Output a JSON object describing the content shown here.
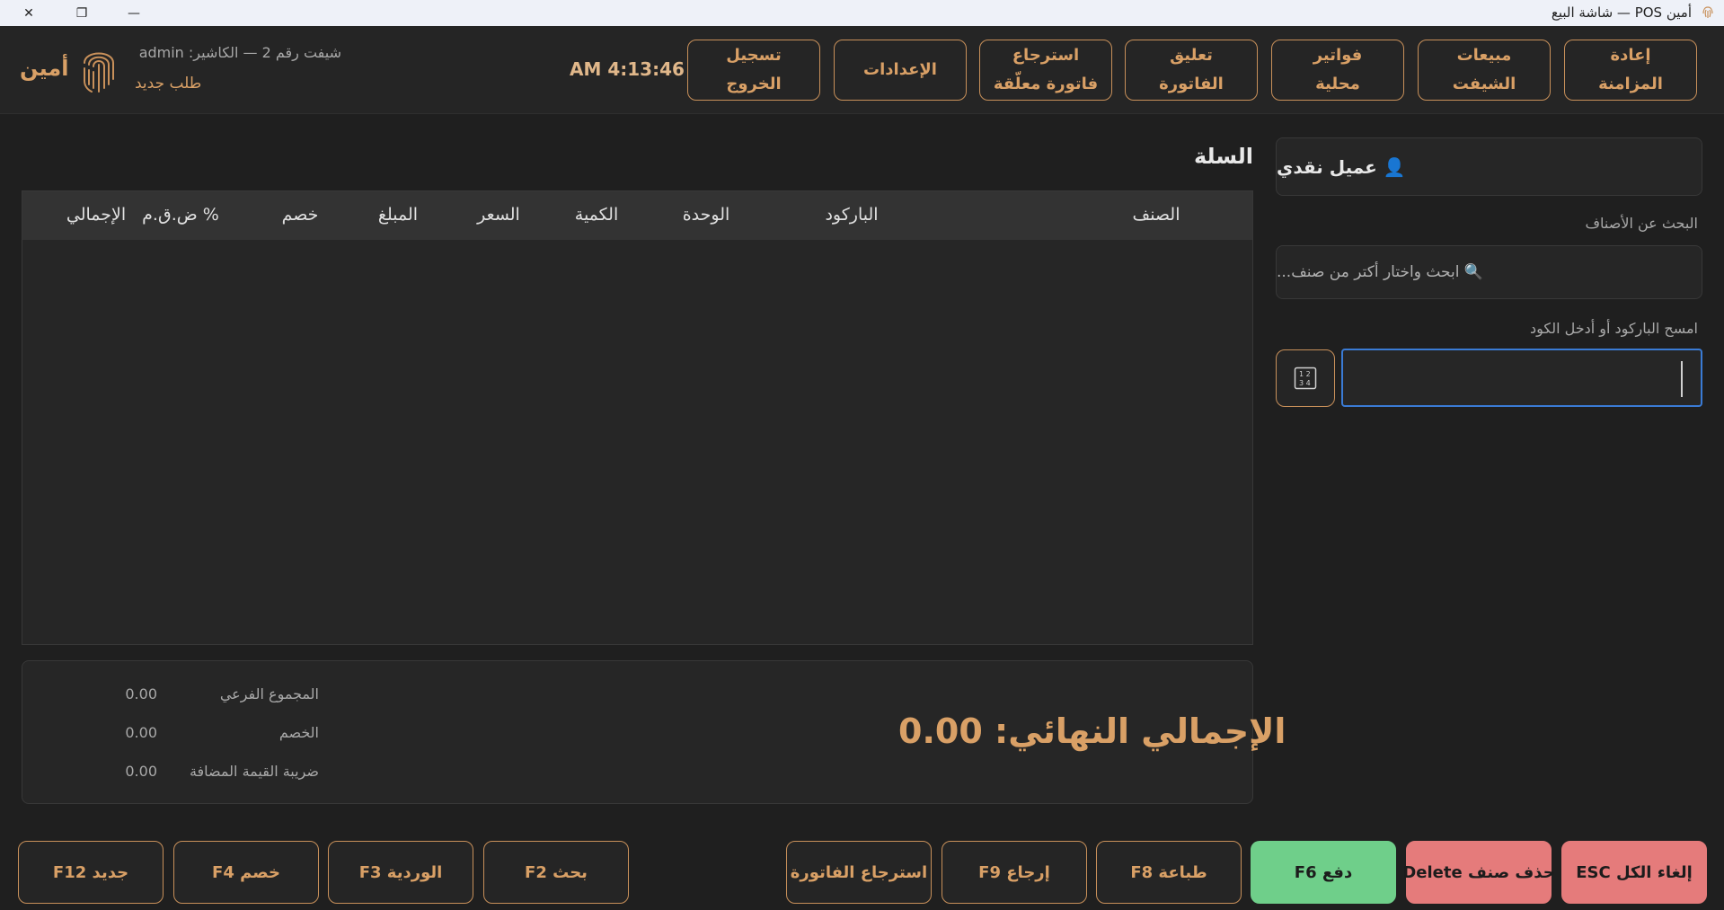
{
  "window": {
    "title": "أمين POS — شاشة البيع",
    "close_glyph": "✕",
    "restore_glyph": "❐",
    "minimize_glyph": "—"
  },
  "header": {
    "buttons": [
      {
        "label": "إعادة\nالمزامنة"
      },
      {
        "label": "مبيعات\nالشيفت"
      },
      {
        "label": "فواتير\nمحلية"
      },
      {
        "label": "تعليق\nالفاتورة"
      },
      {
        "label": "استرجاع\nفاتورة معلّقة"
      },
      {
        "label": "الإعدادات"
      },
      {
        "label": "تسجيل\nالخروج"
      }
    ],
    "clock": "AM 4:13:46",
    "shift_info": "شيفت رقم 2 — الكاشير: admin",
    "new_order": "طلب جديد",
    "brand": "أمين"
  },
  "sidebar": {
    "customer": "👤 عميل نقدي",
    "search_label": "البحث عن الأصناف",
    "search_placeholder": "🔍 ابحث واختار أكتر من صنف...",
    "barcode_label": "امسح الباركود أو أدخل الكود",
    "barcode_value": ""
  },
  "cart": {
    "title": "السلة",
    "columns": [
      "الصنف",
      "الباركود",
      "الوحدة",
      "الكمية",
      "السعر",
      "المبلغ",
      "خصم",
      "ض.ق.م %",
      "الإجمالي"
    ],
    "rows": []
  },
  "summary": {
    "grand_total": "الإجمالي النهائي:  0.00",
    "lines": [
      {
        "label": "المجموع الفرعي",
        "value": "0.00"
      },
      {
        "label": "الخصم",
        "value": "0.00"
      },
      {
        "label": "ضريبة القيمة المضافة",
        "value": "0.00"
      }
    ]
  },
  "footer": {
    "buttons": [
      {
        "label": "ESC إلغاء الكل",
        "style": "red"
      },
      {
        "label": "Delete حذف صنف",
        "style": "red"
      },
      {
        "label": "F6 دفع",
        "style": "green"
      },
      {
        "label": "F8 طباعة",
        "style": "outline"
      },
      {
        "label": "F9 إرجاع",
        "style": "outline"
      },
      {
        "label": "استرجاع الفاتورة",
        "style": "outline"
      },
      {
        "label": "F2 بحث",
        "style": "outline"
      },
      {
        "label": "F3 الوردية",
        "style": "outline"
      },
      {
        "label": "F4 خصم",
        "style": "outline"
      },
      {
        "label": "F12 جديد",
        "style": "outline"
      }
    ]
  },
  "colors": {
    "accent": "#d9a066",
    "background": "#1f1f1f",
    "panel": "#262626",
    "pay_green": "#6fcf8a",
    "danger_red": "#e57b7b",
    "focus_blue": "#3a7bd5"
  }
}
